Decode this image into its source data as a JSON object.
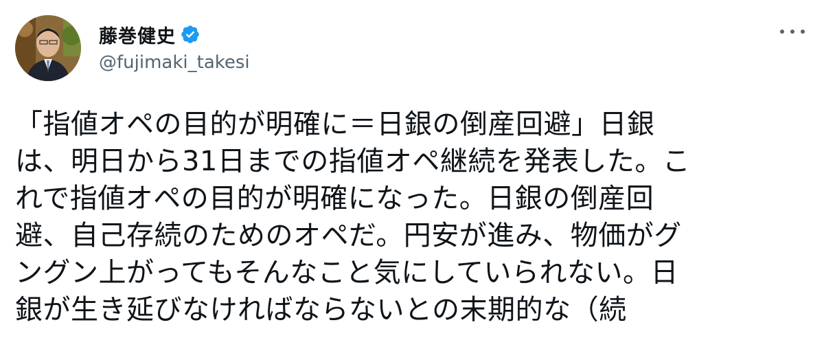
{
  "tweet": {
    "author": {
      "display_name": "藤巻健史",
      "handle": "@fujimaki_takesi",
      "verified": true
    },
    "more_icon": "more-horizontal-icon",
    "text_lines": [
      "「指値オペの目的が明確に＝日銀の倒産回避」日銀",
      "は、明日から31日までの指値オペ継続を発表した。こ",
      "れで指値オペの目的が明確になった。日銀の倒産回",
      "避、自己存続のためのオペだ。円安が進み、物価がグ",
      "ングン上がってもそんなこと気にしていられない。日",
      "銀が生き延びなければならないとの末期的な（続"
    ]
  },
  "colors": {
    "text_primary": "#0f1419",
    "text_secondary": "#536471",
    "verified_blue": "#1d9bf0"
  }
}
